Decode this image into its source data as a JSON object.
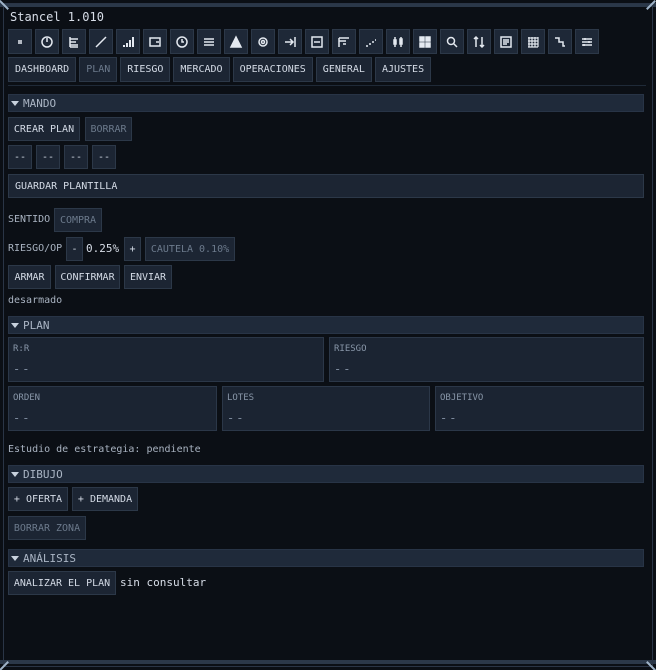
{
  "app": {
    "title": "Stancel 1.010"
  },
  "toolbar_icons": [
    "menu-icon",
    "power-icon",
    "tree-icon",
    "line-icon",
    "bars-icon",
    "wallet-icon",
    "clock-icon",
    "list-icon",
    "peak-icon",
    "gear-icon",
    "exit-icon",
    "panel-icon",
    "steps-icon",
    "trend-icon",
    "candles-icon",
    "grid-icon",
    "search-icon",
    "sort-icon",
    "document-icon",
    "grid-dense-icon",
    "stairs-icon",
    "sliders-icon"
  ],
  "tabs": [
    "DASHBOARD",
    "PLAN",
    "RIESGO",
    "MERCADO",
    "OPERACIONES",
    "GENERAL",
    "AJUSTES"
  ],
  "mando": {
    "header": "MANDO",
    "crear": "CREAR PLAN",
    "borrar": "BORRAR",
    "slots": [
      "--",
      "--",
      "--",
      "--"
    ],
    "guardar": "GUARDAR PLANTILLA",
    "sentido_label": "SENTIDO",
    "sentido_value": "COMPRA",
    "riesgo_label": "RIESGO/OP",
    "minus": "-",
    "riesgo_value": "0.25%",
    "plus": "+",
    "cautela": "CAUTELA 0.10%",
    "armar": "ARMAR",
    "confirmar": "CONFIRMAR",
    "enviar": "ENVIAR",
    "estado": "desarmado"
  },
  "plan": {
    "header": "PLAN",
    "cards": [
      {
        "label": "R:R",
        "value": "--"
      },
      {
        "label": "RIESGO",
        "value": "--"
      },
      {
        "label": "ORDEN",
        "value": "--"
      },
      {
        "label": "LOTES",
        "value": "--"
      },
      {
        "label": "OBJETIVO",
        "value": "--"
      }
    ],
    "estudio": "Estudio de estrategia: pendiente"
  },
  "dibujo": {
    "header": "DIBUJO",
    "oferta": "+ OFERTA",
    "demanda": "+ DEMANDA",
    "borrar_zona": "BORRAR ZONA"
  },
  "analisis": {
    "header": "ANÁLISIS",
    "analizar": "ANALIZAR EL PLAN",
    "estado": "sin consultar"
  }
}
